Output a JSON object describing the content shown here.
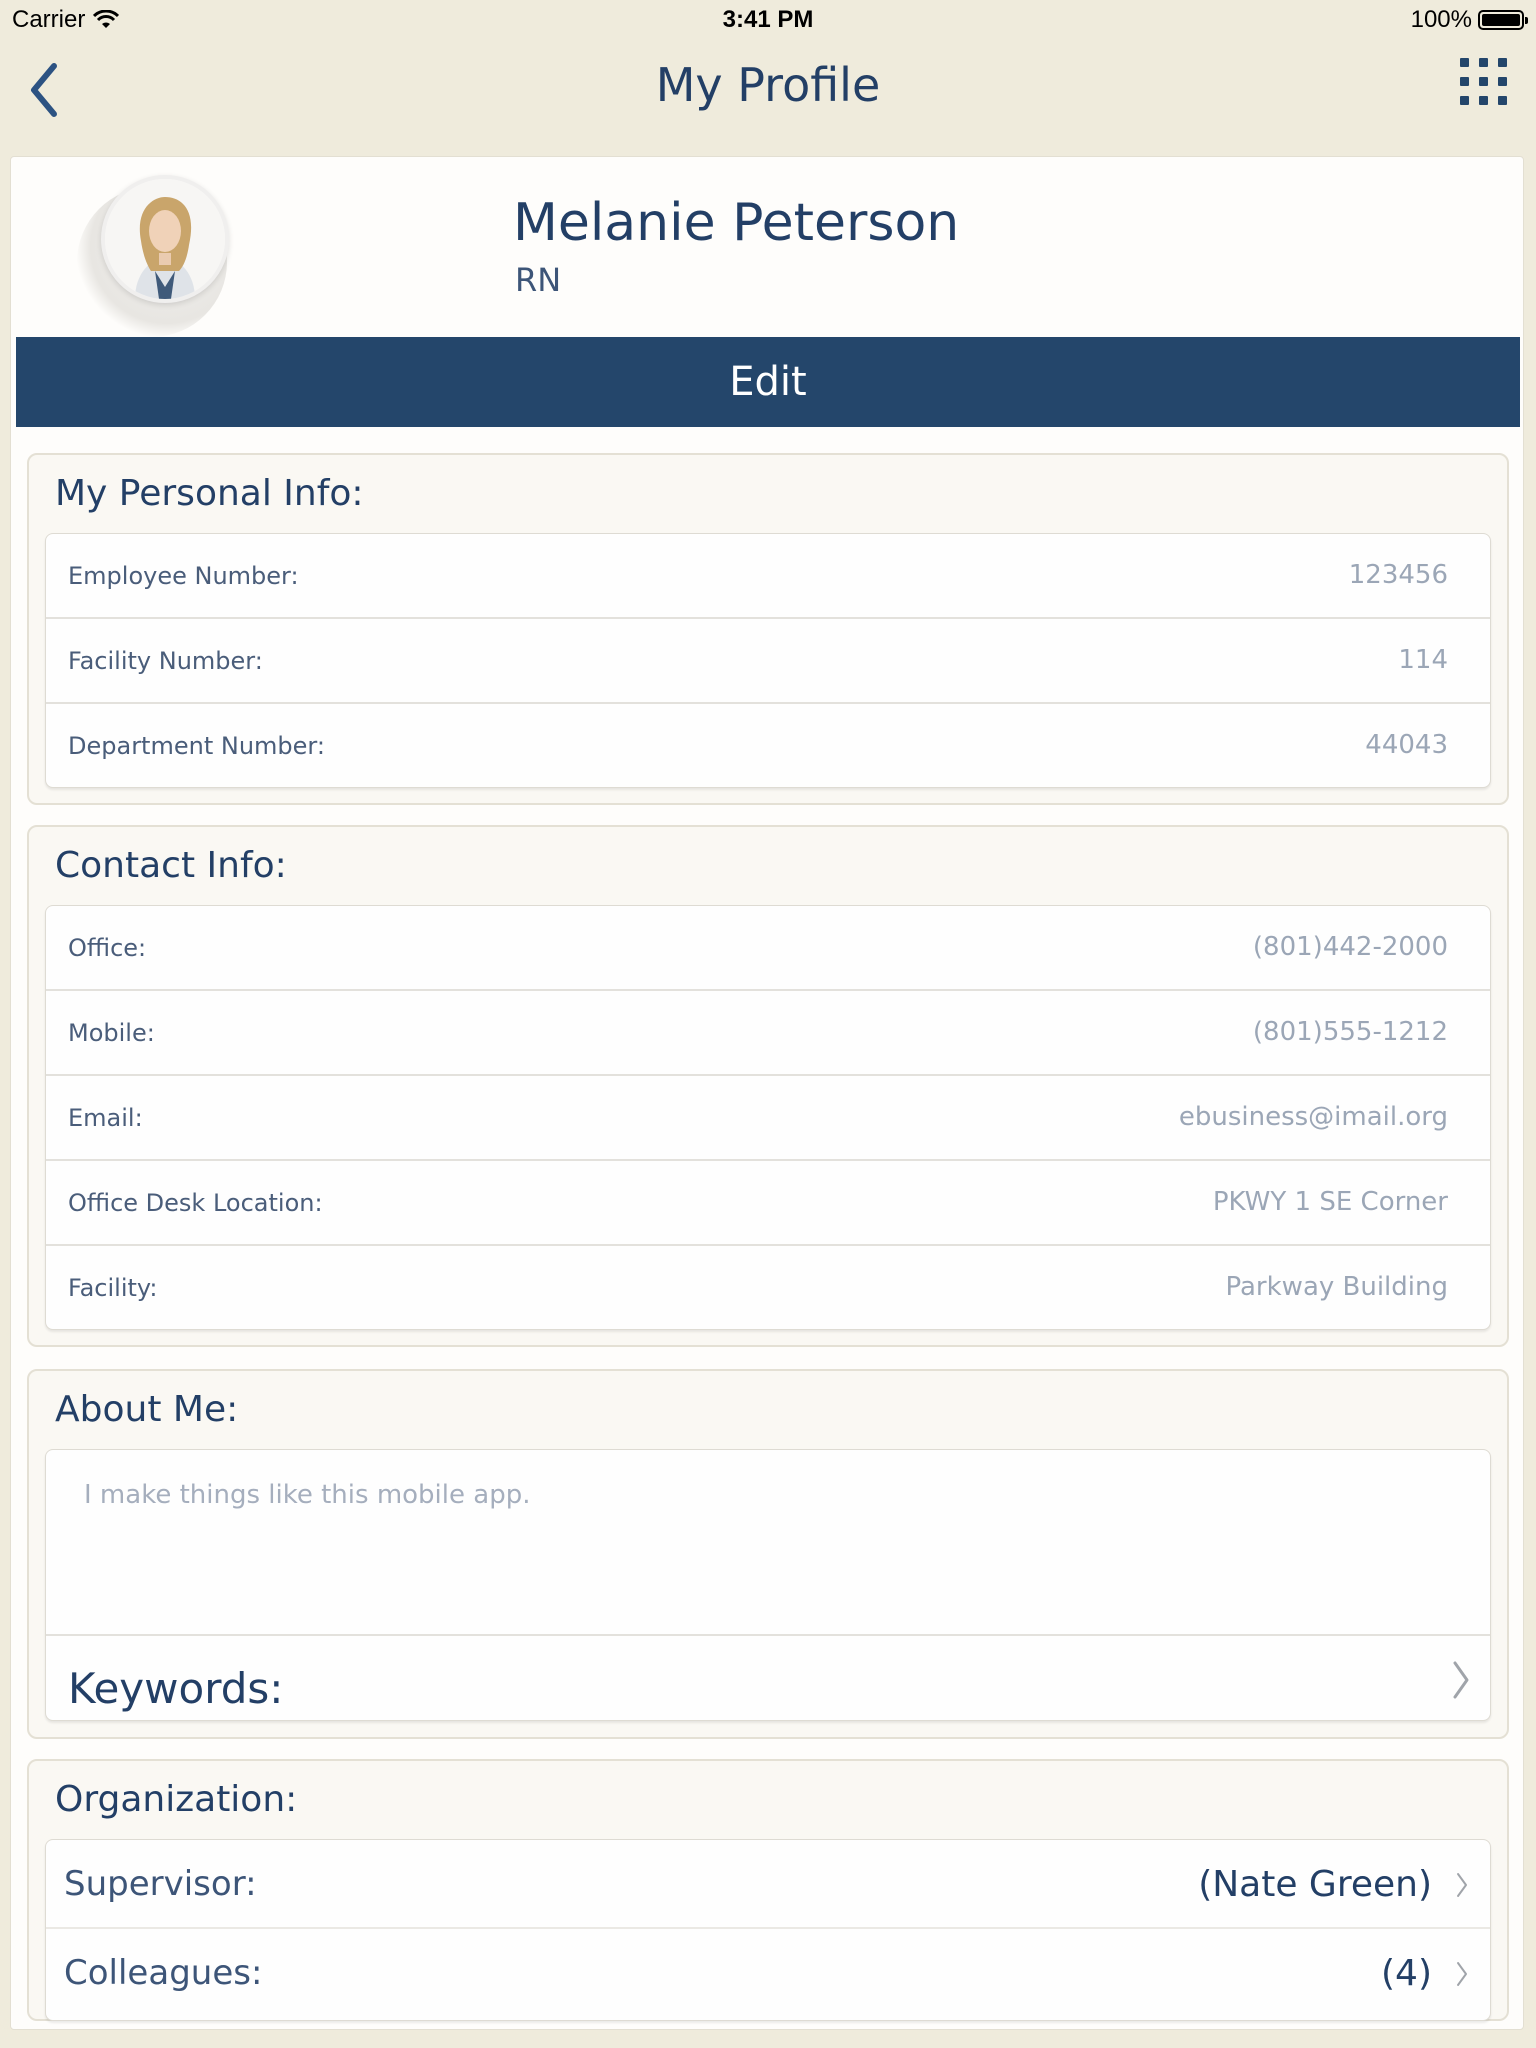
{
  "status_bar": {
    "carrier": "Carrier",
    "time": "3:41 PM",
    "battery": "100%"
  },
  "nav": {
    "title": "My Profile",
    "back_icon": "chevron-left-icon",
    "menu_icon": "grid-menu-icon"
  },
  "profile": {
    "name": "Melanie Peterson",
    "role": "RN",
    "edit_label": "Edit"
  },
  "personal_info": {
    "title": "My Personal Info:",
    "rows": [
      {
        "label": "Employee Number:",
        "value": "123456"
      },
      {
        "label": "Facility Number:",
        "value": "114"
      },
      {
        "label": "Department Number:",
        "value": "44043"
      }
    ]
  },
  "contact_info": {
    "title": "Contact Info:",
    "rows": [
      {
        "label": "Office:",
        "value": "(801)442-2000"
      },
      {
        "label": "Mobile:",
        "value": "(801)555-1212"
      },
      {
        "label": "Email:",
        "value": "ebusiness@imail.org"
      },
      {
        "label": "Office Desk Location:",
        "value": "PKWY 1 SE Corner"
      },
      {
        "label": "Facility:",
        "value": "Parkway Building"
      }
    ]
  },
  "about": {
    "title": "About Me:",
    "text": "I make things like this mobile app.",
    "keywords_label": "Keywords:"
  },
  "organization": {
    "title": "Organization:",
    "rows": [
      {
        "label": "Supervisor:",
        "value": "(Nate Green)"
      },
      {
        "label": "Colleagues:",
        "value": "(4)"
      }
    ]
  },
  "colors": {
    "background": "#efebdc",
    "primary": "#24466b",
    "text": "#233f66",
    "muted_value": "#9ba6b6"
  }
}
